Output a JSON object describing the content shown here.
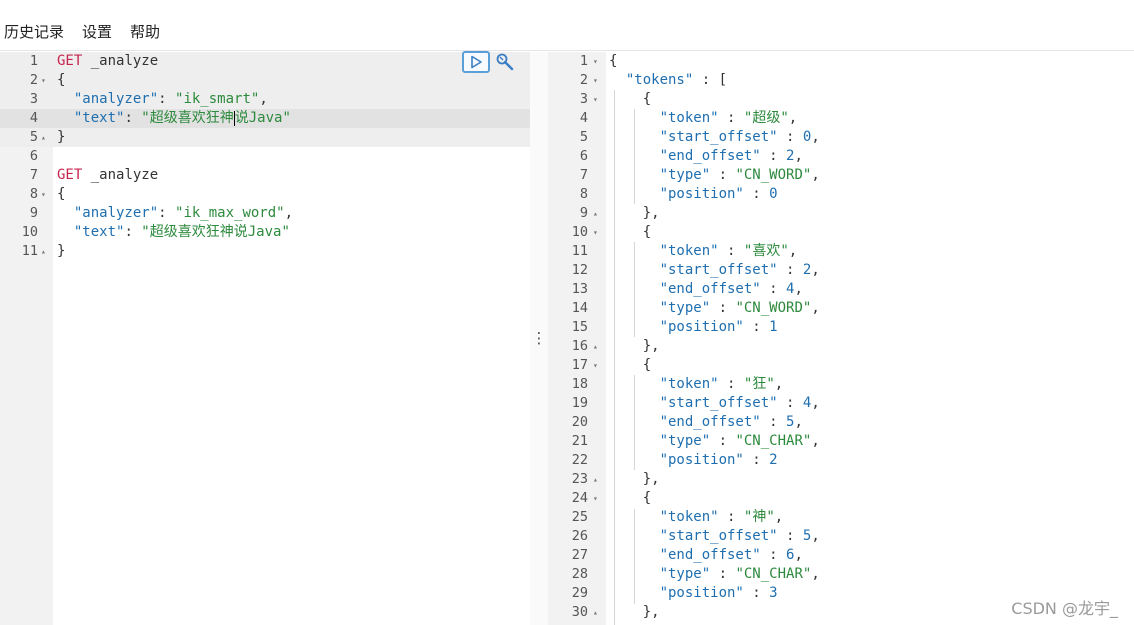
{
  "menu": {
    "items": [
      "历史记录",
      "设置",
      "帮助"
    ]
  },
  "left_editor": {
    "lines": [
      {
        "n": "1",
        "fold": "",
        "parts": [
          [
            "kw",
            "GET"
          ],
          [
            "pun",
            " "
          ],
          [
            "pun",
            "_analyze"
          ]
        ]
      },
      {
        "n": "2",
        "fold": "▾",
        "parts": [
          [
            "pun",
            "{"
          ]
        ]
      },
      {
        "n": "3",
        "fold": "",
        "parts": [
          [
            "pun",
            "  "
          ],
          [
            "key",
            "\"analyzer\""
          ],
          [
            "pun",
            ": "
          ],
          [
            "str",
            "\"ik_smart\""
          ],
          [
            "pun",
            ","
          ]
        ]
      },
      {
        "n": "4",
        "fold": "",
        "parts": [
          [
            "pun",
            "  "
          ],
          [
            "key",
            "\"text\""
          ],
          [
            "pun",
            ": "
          ],
          [
            "str",
            "\"超级喜欢狂神"
          ],
          [
            "cursor",
            ""
          ],
          [
            "str",
            "说Java\""
          ]
        ]
      },
      {
        "n": "5",
        "fold": "▴",
        "parts": [
          [
            "pun",
            "}"
          ]
        ]
      },
      {
        "n": "6",
        "fold": "",
        "parts": []
      },
      {
        "n": "7",
        "fold": "",
        "parts": [
          [
            "kw",
            "GET"
          ],
          [
            "pun",
            " "
          ],
          [
            "pun",
            "_analyze"
          ]
        ]
      },
      {
        "n": "8",
        "fold": "▾",
        "parts": [
          [
            "pun",
            "{"
          ]
        ]
      },
      {
        "n": "9",
        "fold": "",
        "parts": [
          [
            "pun",
            "  "
          ],
          [
            "key",
            "\"analyzer\""
          ],
          [
            "pun",
            ": "
          ],
          [
            "str",
            "\"ik_max_word\""
          ],
          [
            "pun",
            ","
          ]
        ]
      },
      {
        "n": "10",
        "fold": "",
        "parts": [
          [
            "pun",
            "  "
          ],
          [
            "key",
            "\"text\""
          ],
          [
            "pun",
            ": "
          ],
          [
            "str",
            "\"超级喜欢狂神说Java\""
          ]
        ]
      },
      {
        "n": "11",
        "fold": "▴",
        "parts": [
          [
            "pun",
            "}"
          ]
        ]
      }
    ]
  },
  "right_editor": {
    "lines": [
      {
        "n": "1",
        "fold": "▾",
        "parts": [
          [
            "pun",
            "{"
          ]
        ]
      },
      {
        "n": "2",
        "fold": "▾",
        "parts": [
          [
            "pun",
            "  "
          ],
          [
            "key",
            "\"tokens\""
          ],
          [
            "pun",
            " : ["
          ]
        ]
      },
      {
        "n": "3",
        "fold": "▾",
        "parts": [
          [
            "pun",
            "    {"
          ]
        ]
      },
      {
        "n": "4",
        "fold": "",
        "parts": [
          [
            "pun",
            "      "
          ],
          [
            "key",
            "\"token\""
          ],
          [
            "pun",
            " : "
          ],
          [
            "str",
            "\"超级\""
          ],
          [
            "pun",
            ","
          ]
        ]
      },
      {
        "n": "5",
        "fold": "",
        "parts": [
          [
            "pun",
            "      "
          ],
          [
            "key",
            "\"start_offset\""
          ],
          [
            "pun",
            " : "
          ],
          [
            "num",
            "0"
          ],
          [
            "pun",
            ","
          ]
        ]
      },
      {
        "n": "6",
        "fold": "",
        "parts": [
          [
            "pun",
            "      "
          ],
          [
            "key",
            "\"end_offset\""
          ],
          [
            "pun",
            " : "
          ],
          [
            "num",
            "2"
          ],
          [
            "pun",
            ","
          ]
        ]
      },
      {
        "n": "7",
        "fold": "",
        "parts": [
          [
            "pun",
            "      "
          ],
          [
            "key",
            "\"type\""
          ],
          [
            "pun",
            " : "
          ],
          [
            "str",
            "\"CN_WORD\""
          ],
          [
            "pun",
            ","
          ]
        ]
      },
      {
        "n": "8",
        "fold": "",
        "parts": [
          [
            "pun",
            "      "
          ],
          [
            "key",
            "\"position\""
          ],
          [
            "pun",
            " : "
          ],
          [
            "num",
            "0"
          ]
        ]
      },
      {
        "n": "9",
        "fold": "▴",
        "parts": [
          [
            "pun",
            "    },"
          ]
        ]
      },
      {
        "n": "10",
        "fold": "▾",
        "parts": [
          [
            "pun",
            "    {"
          ]
        ]
      },
      {
        "n": "11",
        "fold": "",
        "parts": [
          [
            "pun",
            "      "
          ],
          [
            "key",
            "\"token\""
          ],
          [
            "pun",
            " : "
          ],
          [
            "str",
            "\"喜欢\""
          ],
          [
            "pun",
            ","
          ]
        ]
      },
      {
        "n": "12",
        "fold": "",
        "parts": [
          [
            "pun",
            "      "
          ],
          [
            "key",
            "\"start_offset\""
          ],
          [
            "pun",
            " : "
          ],
          [
            "num",
            "2"
          ],
          [
            "pun",
            ","
          ]
        ]
      },
      {
        "n": "13",
        "fold": "",
        "parts": [
          [
            "pun",
            "      "
          ],
          [
            "key",
            "\"end_offset\""
          ],
          [
            "pun",
            " : "
          ],
          [
            "num",
            "4"
          ],
          [
            "pun",
            ","
          ]
        ]
      },
      {
        "n": "14",
        "fold": "",
        "parts": [
          [
            "pun",
            "      "
          ],
          [
            "key",
            "\"type\""
          ],
          [
            "pun",
            " : "
          ],
          [
            "str",
            "\"CN_WORD\""
          ],
          [
            "pun",
            ","
          ]
        ]
      },
      {
        "n": "15",
        "fold": "",
        "parts": [
          [
            "pun",
            "      "
          ],
          [
            "key",
            "\"position\""
          ],
          [
            "pun",
            " : "
          ],
          [
            "num",
            "1"
          ]
        ]
      },
      {
        "n": "16",
        "fold": "▴",
        "parts": [
          [
            "pun",
            "    },"
          ]
        ]
      },
      {
        "n": "17",
        "fold": "▾",
        "parts": [
          [
            "pun",
            "    {"
          ]
        ]
      },
      {
        "n": "18",
        "fold": "",
        "parts": [
          [
            "pun",
            "      "
          ],
          [
            "key",
            "\"token\""
          ],
          [
            "pun",
            " : "
          ],
          [
            "str",
            "\"狂\""
          ],
          [
            "pun",
            ","
          ]
        ]
      },
      {
        "n": "19",
        "fold": "",
        "parts": [
          [
            "pun",
            "      "
          ],
          [
            "key",
            "\"start_offset\""
          ],
          [
            "pun",
            " : "
          ],
          [
            "num",
            "4"
          ],
          [
            "pun",
            ","
          ]
        ]
      },
      {
        "n": "20",
        "fold": "",
        "parts": [
          [
            "pun",
            "      "
          ],
          [
            "key",
            "\"end_offset\""
          ],
          [
            "pun",
            " : "
          ],
          [
            "num",
            "5"
          ],
          [
            "pun",
            ","
          ]
        ]
      },
      {
        "n": "21",
        "fold": "",
        "parts": [
          [
            "pun",
            "      "
          ],
          [
            "key",
            "\"type\""
          ],
          [
            "pun",
            " : "
          ],
          [
            "str",
            "\"CN_CHAR\""
          ],
          [
            "pun",
            ","
          ]
        ]
      },
      {
        "n": "22",
        "fold": "",
        "parts": [
          [
            "pun",
            "      "
          ],
          [
            "key",
            "\"position\""
          ],
          [
            "pun",
            " : "
          ],
          [
            "num",
            "2"
          ]
        ]
      },
      {
        "n": "23",
        "fold": "▴",
        "parts": [
          [
            "pun",
            "    },"
          ]
        ]
      },
      {
        "n": "24",
        "fold": "▾",
        "parts": [
          [
            "pun",
            "    {"
          ]
        ]
      },
      {
        "n": "25",
        "fold": "",
        "parts": [
          [
            "pun",
            "      "
          ],
          [
            "key",
            "\"token\""
          ],
          [
            "pun",
            " : "
          ],
          [
            "str",
            "\"神\""
          ],
          [
            "pun",
            ","
          ]
        ]
      },
      {
        "n": "26",
        "fold": "",
        "parts": [
          [
            "pun",
            "      "
          ],
          [
            "key",
            "\"start_offset\""
          ],
          [
            "pun",
            " : "
          ],
          [
            "num",
            "5"
          ],
          [
            "pun",
            ","
          ]
        ]
      },
      {
        "n": "27",
        "fold": "",
        "parts": [
          [
            "pun",
            "      "
          ],
          [
            "key",
            "\"end_offset\""
          ],
          [
            "pun",
            " : "
          ],
          [
            "num",
            "6"
          ],
          [
            "pun",
            ","
          ]
        ]
      },
      {
        "n": "28",
        "fold": "",
        "parts": [
          [
            "pun",
            "      "
          ],
          [
            "key",
            "\"type\""
          ],
          [
            "pun",
            " : "
          ],
          [
            "str",
            "\"CN_CHAR\""
          ],
          [
            "pun",
            ","
          ]
        ]
      },
      {
        "n": "29",
        "fold": "",
        "parts": [
          [
            "pun",
            "      "
          ],
          [
            "key",
            "\"position\""
          ],
          [
            "pun",
            " : "
          ],
          [
            "num",
            "3"
          ]
        ]
      },
      {
        "n": "30",
        "fold": "▴",
        "parts": [
          [
            "pun",
            "    },"
          ]
        ]
      }
    ]
  },
  "icons": {
    "run": "play-icon",
    "tools": "wrench-icon",
    "splitter": "vertical-dots-icon"
  },
  "splitter_glyph": "⋮",
  "watermark": "CSDN @龙宇_"
}
